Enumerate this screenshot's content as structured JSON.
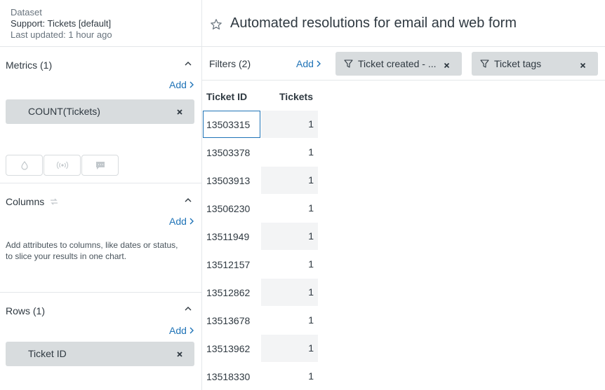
{
  "dataset": {
    "label": "Dataset",
    "name": "Support: Tickets [default]",
    "updated": "Last updated: 1 hour ago"
  },
  "report": {
    "title": "Automated resolutions for email and web form"
  },
  "metrics": {
    "title": "Metrics (1)",
    "add_label": "Add",
    "item": "COUNT(Tickets)"
  },
  "columns": {
    "title": "Columns",
    "add_label": "Add",
    "help": "Add attributes to columns, like dates or status, to slice your results in one chart."
  },
  "rows": {
    "title": "Rows (1)",
    "add_label": "Add",
    "item": "Ticket ID"
  },
  "filters": {
    "title": "Filters (2)",
    "add_label": "Add",
    "chips": [
      "Ticket created - ...",
      "Ticket tags"
    ]
  },
  "table": {
    "headers": [
      "Ticket ID",
      "Tickets"
    ],
    "rows": [
      [
        "13503315",
        "1"
      ],
      [
        "13503378",
        "1"
      ],
      [
        "13503913",
        "1"
      ],
      [
        "13506230",
        "1"
      ],
      [
        "13511949",
        "1"
      ],
      [
        "13512157",
        "1"
      ],
      [
        "13512862",
        "1"
      ],
      [
        "13513678",
        "1"
      ],
      [
        "13513962",
        "1"
      ],
      [
        "13518330",
        "1"
      ]
    ]
  },
  "icons": {
    "viz": [
      "drop-icon",
      "broadcast-icon",
      "comment-icon"
    ],
    "filter": "filter-icon",
    "star": "star-icon",
    "swap": "swap-icon"
  },
  "colors": {
    "accent": "#1f73b7",
    "chip": "#d8dcde",
    "stripe": "#f3f4f5"
  }
}
